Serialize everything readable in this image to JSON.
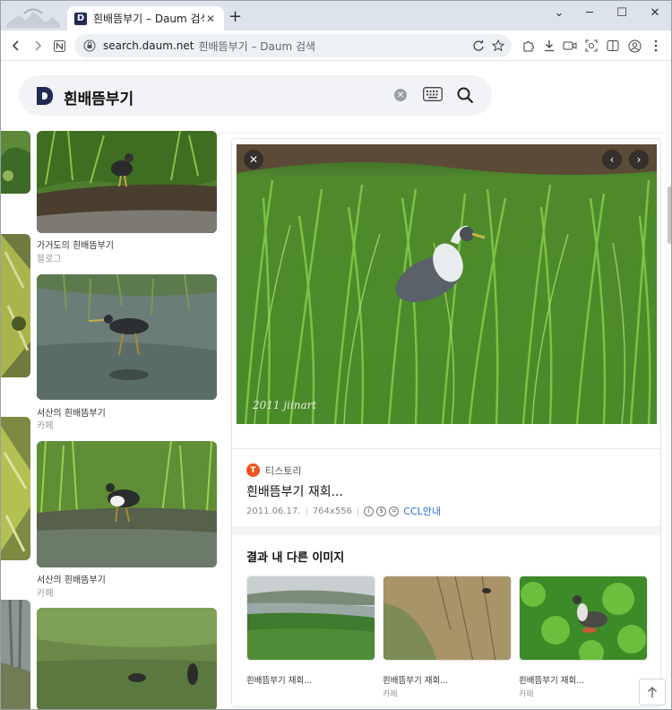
{
  "browser": {
    "tab_title": "흰배뜸부기 – Daum 검색",
    "favicon_letter": "D",
    "new_tab": "+",
    "tab_close": "✕",
    "url_domain": "search.daum.net",
    "url_rest": "흰배뜸부기 – Daum 검색",
    "window_controls": [
      "⌄",
      "─",
      "☐",
      "✕"
    ]
  },
  "search": {
    "query": "흰배뜸부기",
    "clear_label": "✕"
  },
  "results": [
    {
      "title": "가거도의 흰배뜸부기",
      "source": "블로그"
    },
    {
      "title": "서산의 흰배뜸부기",
      "source": "카페"
    },
    {
      "title": "서산의 흰배뜸부기",
      "source": "카페"
    }
  ],
  "detail": {
    "watermark": "2011 jiinart",
    "source_name": "티스토리",
    "source_icon_letter": "T",
    "title": "흰배뜸부기 재회...",
    "date": "2011.06.17.",
    "size": "764x556",
    "cc_icons": [
      "i",
      "$",
      "="
    ],
    "ccl_link": "CCL안내",
    "related_heading": "결과 내 다른 이미지",
    "related": [
      {
        "title": "흰배뜸부기 재회...",
        "source": ""
      },
      {
        "title": "흰배뜸부기 재회...",
        "source": "카페"
      },
      {
        "title": "흰배뜸부기 재회...",
        "source": "카페"
      }
    ]
  },
  "colors": {
    "accent_link": "#2c6bd8",
    "daum_navy": "#1f2a55",
    "tistory_orange": "#eb531f"
  }
}
